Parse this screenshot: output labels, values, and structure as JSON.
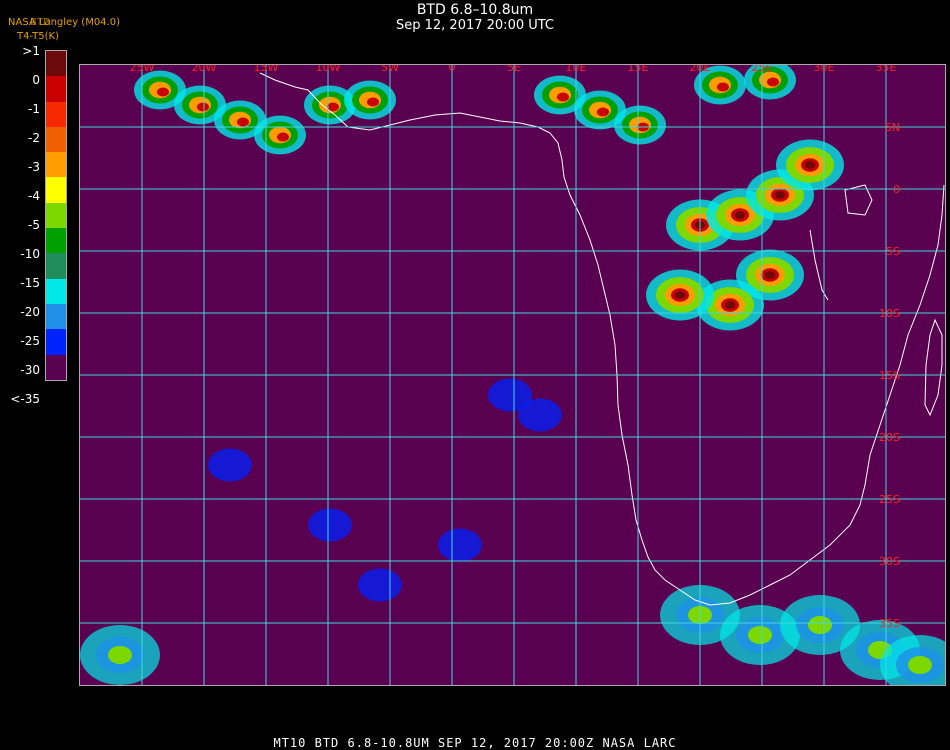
{
  "header": {
    "title": "BTD 6.8–10.8um",
    "datetime": "Sep 12, 2017 20:00 UTC",
    "credit_1": "NASA Langley (M04.0)",
    "credit_2": "T4-T5(K)",
    "credit_3": "BTD"
  },
  "legend": {
    "labels": [
      ">1",
      "0",
      "-1",
      "-2",
      "-3",
      "-4",
      "-5",
      "-10",
      "-15",
      "-20",
      "-25",
      "-30",
      "<-35"
    ],
    "colors": [
      "#6a0a0a",
      "#c80000",
      "#f52a00",
      "#f06000",
      "#ff9c00",
      "#ffff00",
      "#7cd800",
      "#00a000",
      "#1f8c5a",
      "#00e8e8",
      "#1e90e8",
      "#0022ff",
      "#5a0050"
    ]
  },
  "map": {
    "background_color": "#5a0050",
    "grid_color": "#3fd8e0",
    "lon_labels": [
      "25W",
      "20W",
      "15W",
      "10W",
      "5W",
      "0",
      "5E",
      "10E",
      "15E",
      "20E",
      "25E",
      "30E",
      "35E"
    ],
    "lat_labels": [
      "5N",
      "0",
      "5S",
      "10S",
      "15S",
      "20S",
      "25S",
      "30S",
      "35S"
    ]
  },
  "footer": {
    "text": "MT10   BTD 6.8-10.8UM    SEP 12, 2017 20:00Z   NASA LARC"
  }
}
